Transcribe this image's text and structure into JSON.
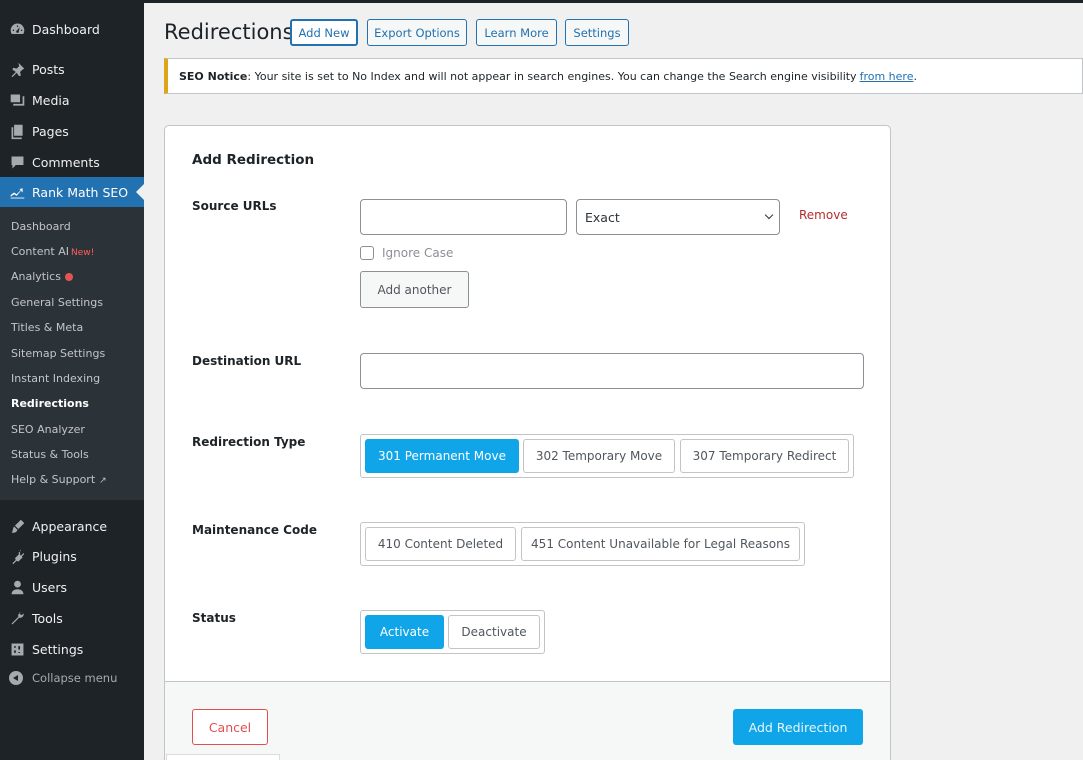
{
  "sidebar": {
    "menu": [
      {
        "key": "dashboard",
        "label": "Dashboard",
        "icon": "dashboard-icon"
      },
      {
        "key": "posts",
        "label": "Posts",
        "icon": "pin-icon"
      },
      {
        "key": "media",
        "label": "Media",
        "icon": "media-icon"
      },
      {
        "key": "pages",
        "label": "Pages",
        "icon": "pages-icon"
      },
      {
        "key": "comments",
        "label": "Comments",
        "icon": "comment-icon"
      },
      {
        "key": "rankmath",
        "label": "Rank Math SEO",
        "icon": "rank-math-icon"
      },
      {
        "key": "appearance",
        "label": "Appearance",
        "icon": "brush-icon"
      },
      {
        "key": "plugins",
        "label": "Plugins",
        "icon": "plug-icon"
      },
      {
        "key": "users",
        "label": "Users",
        "icon": "user-icon"
      },
      {
        "key": "tools",
        "label": "Tools",
        "icon": "wrench-icon"
      },
      {
        "key": "settings",
        "label": "Settings",
        "icon": "sliders-icon"
      }
    ],
    "submenu": [
      {
        "label": "Dashboard"
      },
      {
        "label": "Content AI",
        "badge": "New!"
      },
      {
        "label": "Analytics"
      },
      {
        "label": "General Settings"
      },
      {
        "label": "Titles & Meta"
      },
      {
        "label": "Sitemap Settings"
      },
      {
        "label": "Instant Indexing"
      },
      {
        "label": "Redirections"
      },
      {
        "label": "SEO Analyzer"
      },
      {
        "label": "Status & Tools"
      },
      {
        "label": "Help & Support"
      }
    ],
    "collapse_label": "Collapse menu",
    "accent_color": "#2271b1"
  },
  "header": {
    "title": "Redirections",
    "buttons": [
      "Add New",
      "Export Options",
      "Learn More",
      "Settings"
    ]
  },
  "notice": {
    "label": "SEO Notice",
    "text": ": Your site is set to No Index and will not appear in search engines. You can change the Search engine visibility",
    "link": "from here",
    "end": "."
  },
  "form": {
    "title": "Add Redirection",
    "source": {
      "label": "Source URLs",
      "value": "",
      "match_type": "Exact",
      "remove": "Remove",
      "ignore_case": "Ignore Case",
      "add_another": "Add another"
    },
    "destination": {
      "label": "Destination URL",
      "value": ""
    },
    "type": {
      "label": "Redirection Type",
      "options": [
        "301 Permanent Move",
        "302 Temporary Move",
        "307 Temporary Redirect"
      ],
      "selected": "301 Permanent Move"
    },
    "maintenance": {
      "label": "Maintenance Code",
      "options": [
        "410 Content Deleted",
        "451 Content Unavailable for Legal Reasons"
      ]
    },
    "status": {
      "label": "Status",
      "options": [
        "Activate",
        "Deactivate"
      ],
      "selected": "Activate"
    },
    "cancel": "Cancel",
    "submit": "Add Redirection",
    "accent_color": "#10a4e8"
  }
}
